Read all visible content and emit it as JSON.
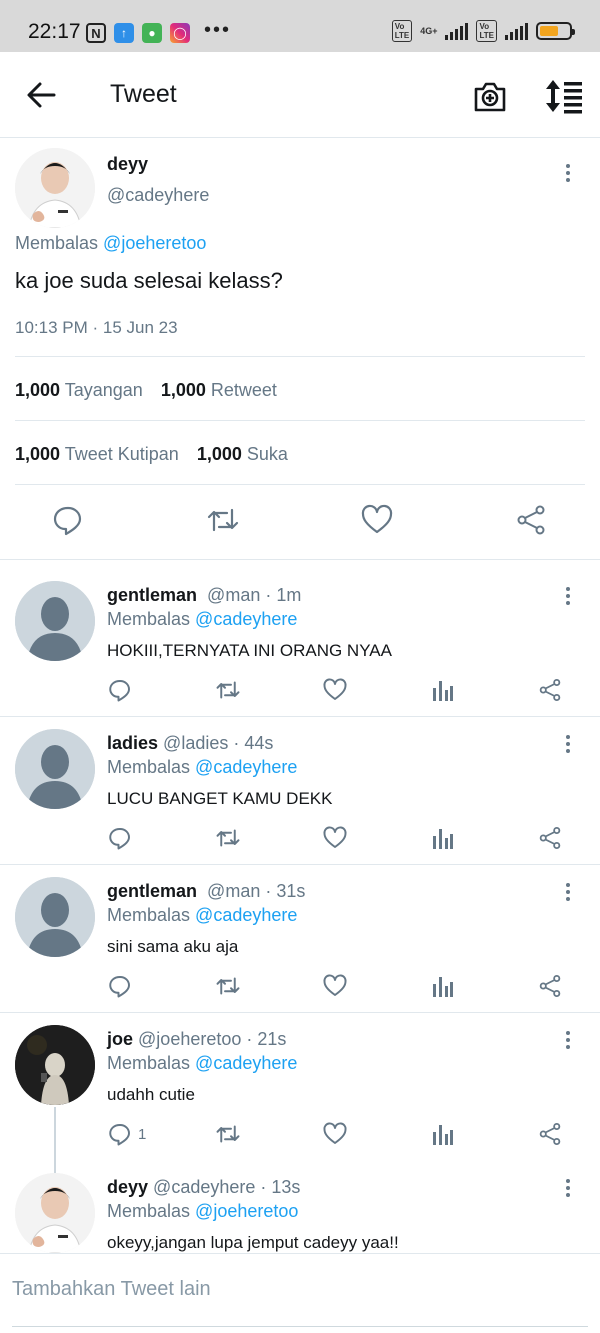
{
  "status_bar": {
    "time": "22:17",
    "network": "4G+",
    "volte": "Vo LTE",
    "more": "•••"
  },
  "header": {
    "title": "Tweet"
  },
  "main_tweet": {
    "name": "deyy",
    "handle": "@cadeyhere",
    "reply_prefix": "Membalas",
    "reply_to": "@joeheretoo",
    "text": "ka joe suda selesai kelass?",
    "timestamp": "10:13 PM · 15 Jun 23",
    "stats": {
      "views_count": "1,000",
      "views_label": "Tayangan",
      "retweets_count": "1,000",
      "retweets_label": "Retweet",
      "quotes_count": "1,000",
      "quotes_label": "Tweet Kutipan",
      "likes_count": "1,000",
      "likes_label": "Suka"
    }
  },
  "replies": [
    {
      "name": "gentleman",
      "handle": "@man · 1m",
      "reply_prefix": "Membalas",
      "reply_to": "@cadeyhere",
      "text": "HOKIII,TERNYATA INI ORANG NYAA",
      "reply_count": ""
    },
    {
      "name": "ladies",
      "handle": "@ladies · 44s",
      "reply_prefix": "Membalas",
      "reply_to": "@cadeyhere",
      "text": "LUCU BANGET KAMU DEKK",
      "reply_count": ""
    },
    {
      "name": "gentleman",
      "handle": "@man · 31s",
      "reply_prefix": "Membalas",
      "reply_to": "@cadeyhere",
      "text": "sini sama aku aja",
      "reply_count": ""
    },
    {
      "name": "joe",
      "handle": "@joeheretoo · 21s",
      "reply_prefix": "Membalas",
      "reply_to": "@cadeyhere",
      "text": "udahh cutie",
      "reply_count": "1"
    },
    {
      "name": "deyy",
      "handle": "@cadeyhere · 13s",
      "reply_prefix": "Membalas",
      "reply_to": "@joeheretoo",
      "text": "okeyy,jangan lupa jemput cadeyy yaa!!",
      "reply_count": ""
    }
  ],
  "composer": {
    "placeholder": "Tambahkan Tweet lain"
  },
  "colors": {
    "link": "#1da1f2",
    "muted": "#657786",
    "divider": "#e1e8ed",
    "status_bar": "#d9d9d9"
  }
}
